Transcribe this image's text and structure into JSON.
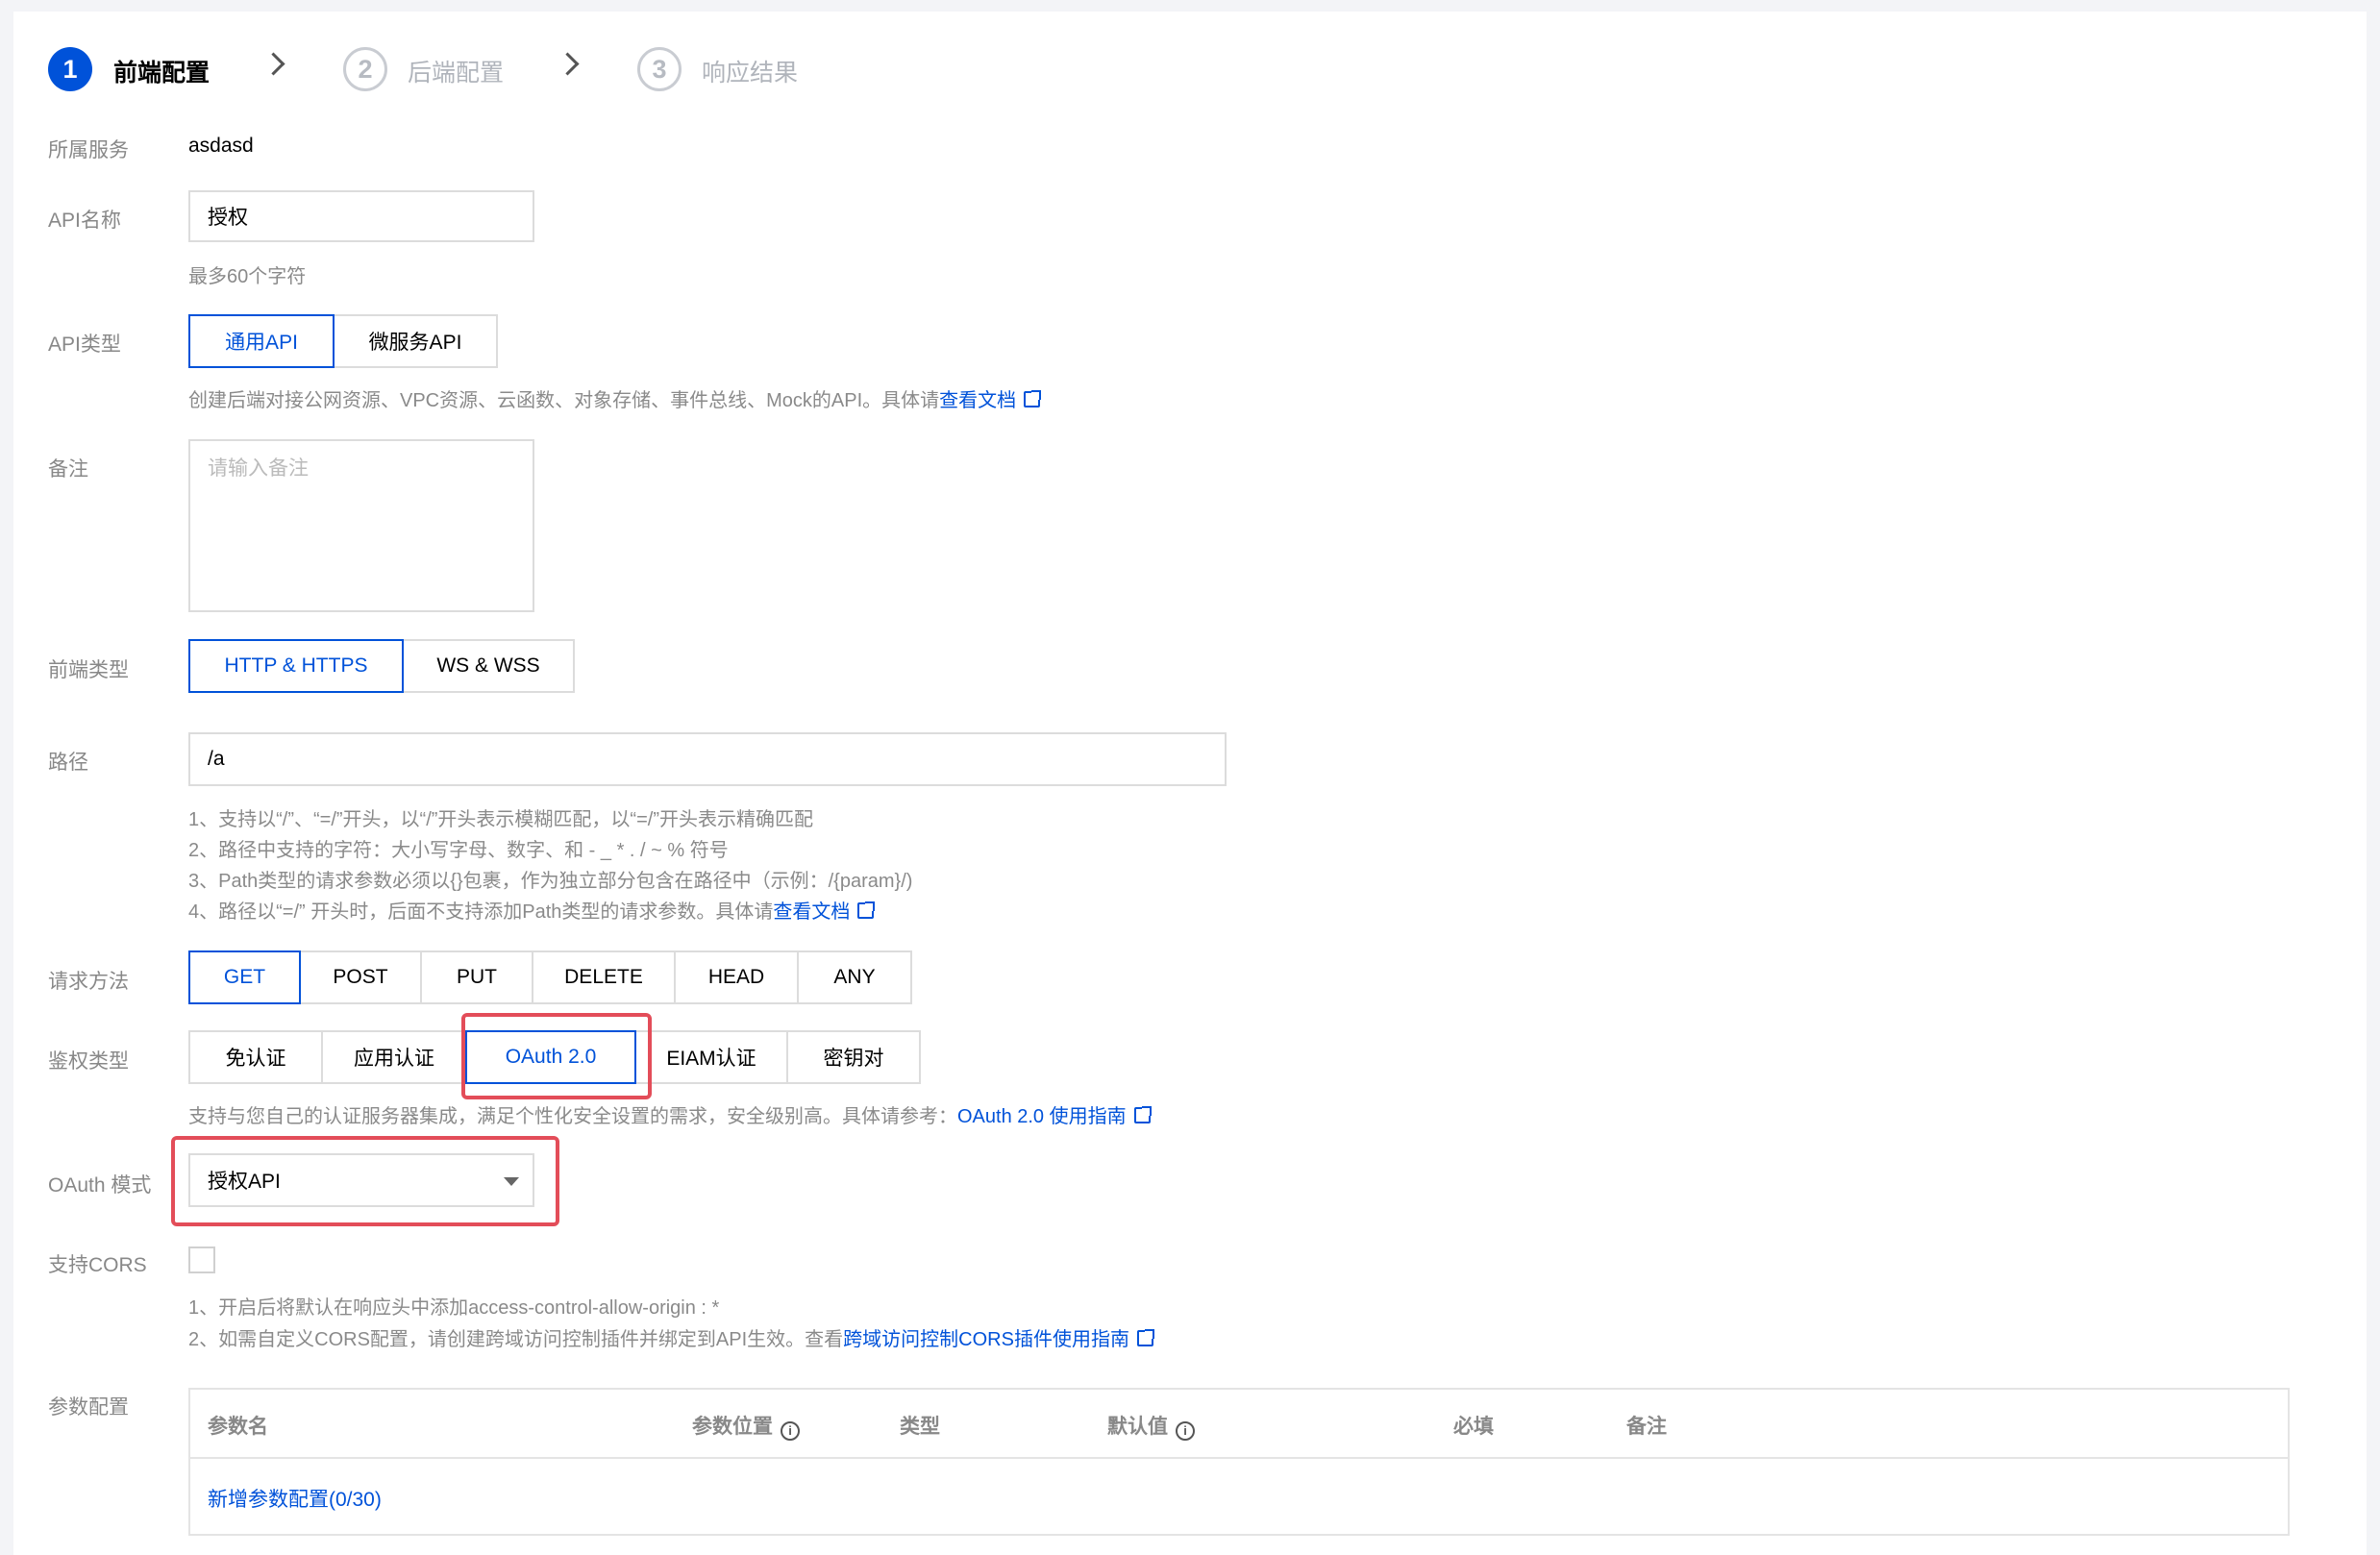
{
  "steps": [
    {
      "num": "1",
      "label": "前端配置"
    },
    {
      "num": "2",
      "label": "后端配置"
    },
    {
      "num": "3",
      "label": "响应结果"
    }
  ],
  "service": {
    "label": "所属服务",
    "value": "asdasd"
  },
  "api_name": {
    "label": "API名称",
    "value": "授权",
    "hint": "最多60个字符"
  },
  "api_type": {
    "label": "API类型",
    "options": [
      "通用API",
      "微服务API"
    ],
    "selected": "通用API",
    "hint": "创建后端对接公网资源、VPC资源、云函数、对象存储、事件总线、Mock的API。具体请",
    "hint_link": "查看文档"
  },
  "remark": {
    "label": "备注",
    "placeholder": "请输入备注"
  },
  "frontend_type": {
    "label": "前端类型",
    "options": [
      "HTTP & HTTPS",
      "WS & WSS"
    ],
    "selected": "HTTP & HTTPS"
  },
  "path": {
    "label": "路径",
    "value": "/a",
    "hints": [
      "1、支持以“/”、“=/”开头，以“/”开头表示模糊匹配，以“=/”开头表示精确匹配",
      "2、路径中支持的字符：大小写字母、数字、和 - _ * . / ~ % 符号",
      "3、Path类型的请求参数必须以{}包裹，作为独立部分包含在路径中（示例：/{param}/)",
      "4、路径以“=/” 开头时，后面不支持添加Path类型的请求参数。具体请"
    ],
    "hint_link": "查看文档"
  },
  "method": {
    "label": "请求方法",
    "options": [
      "GET",
      "POST",
      "PUT",
      "DELETE",
      "HEAD",
      "ANY"
    ],
    "selected": "GET"
  },
  "auth": {
    "label": "鉴权类型",
    "options": [
      "免认证",
      "应用认证",
      "OAuth 2.0",
      "EIAM认证",
      "密钥对"
    ],
    "selected": "OAuth 2.0",
    "hint": "支持与您自己的认证服务器集成，满足个性化安全设置的需求，安全级别高。具体请参考：",
    "hint_link": "OAuth 2.0 使用指南"
  },
  "oauth_mode": {
    "label": "OAuth 模式",
    "value": "授权API"
  },
  "cors": {
    "label": "支持CORS",
    "checked": false,
    "hint1": "1、开启后将默认在响应头中添加access-control-allow-origin : *",
    "hint2": "2、如需自定义CORS配置，请创建跨域访问控制插件并绑定到API生效。查看",
    "hint2_link": "跨域访问控制CORS插件使用指南"
  },
  "params": {
    "label": "参数配置",
    "columns": [
      "参数名",
      "参数位置",
      "类型",
      "默认值",
      "必填",
      "备注"
    ],
    "add_link": "新增参数配置(0/30)"
  },
  "colors": {
    "primary": "#0052d9",
    "highlight": "#e34d59"
  }
}
